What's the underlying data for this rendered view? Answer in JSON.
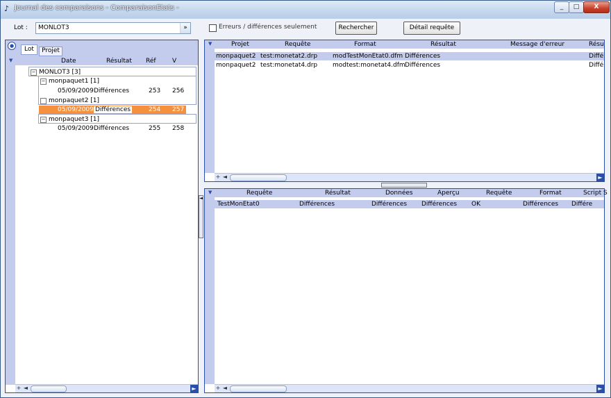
{
  "window": {
    "title": "Journal des comparaisons - ComparaisonEtats -",
    "minimize": "_",
    "maximize": "□",
    "close": "X"
  },
  "toolbar": {
    "lot_label": "Lot :",
    "lot_value": "MONLOT3",
    "lot_arrow": "»",
    "filter_label": "Erreurs / différences seulement",
    "search_button": "Rechercher",
    "detail_button": "Détail requête"
  },
  "left_panel": {
    "tabs": [
      "Lot",
      "Projet"
    ],
    "columns": [
      "Date",
      "Résultat",
      "Réf",
      "V"
    ],
    "root": "MONLOT3 [3]",
    "groups": [
      {
        "name": "monpaquet1 [1]",
        "toggle": "−",
        "row": {
          "date": "05/09/2009",
          "result": "Différences",
          "ref": "253",
          "v": "256"
        }
      },
      {
        "name": "monpaquet2 [1]",
        "toggle": "",
        "row": {
          "date": "05/09/2009",
          "result": "Différences",
          "ref": "254",
          "v": "257"
        }
      },
      {
        "name": "monpaquet3 [1]",
        "toggle": "−",
        "row": {
          "date": "05/09/2009",
          "result": "Différences",
          "ref": "255",
          "v": "258"
        }
      }
    ]
  },
  "top_grid": {
    "columns": [
      "Projet",
      "Requête",
      "Format",
      "Résultat",
      "Message d'erreur",
      "Résu"
    ],
    "rows": [
      [
        "monpaquet2",
        "test:monetat2.drp",
        "modTestMonEtat0.dfm",
        "Différences",
        "",
        "Diffé"
      ],
      [
        "monpaquet2",
        "test:monetat4.drp",
        "modtest:monetat4.dfm",
        "Différences",
        "",
        "Diffé"
      ]
    ]
  },
  "bottom_grid": {
    "columns": [
      "Requête",
      "Résultat",
      "Données",
      "Aperçu",
      "Requête",
      "Format",
      "Script S"
    ],
    "rows": [
      [
        "TestMonEtat0",
        "Différences",
        "Différences",
        "Différences",
        "OK",
        "Différences",
        "Différe"
      ]
    ]
  },
  "scroll": {
    "left": "◄",
    "right": "►",
    "plus": "+"
  },
  "icons": {
    "app": "app-icon",
    "panel": "collapse-icon",
    "sort": "sort-arrow-icon"
  }
}
